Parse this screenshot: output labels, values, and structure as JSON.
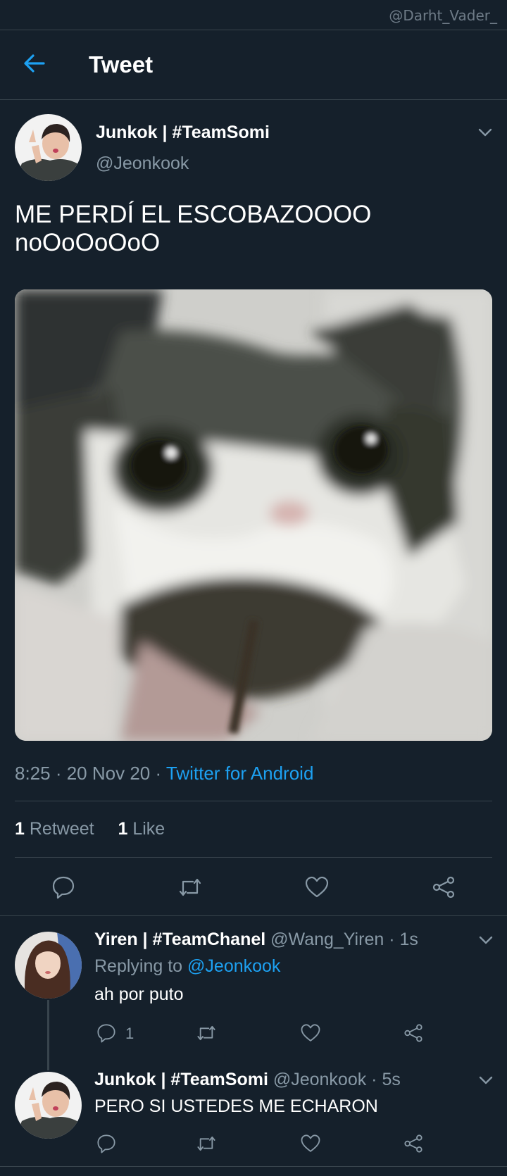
{
  "watermark": "@Darht_Vader_",
  "header": {
    "title": "Tweet"
  },
  "tweet": {
    "author_name": "Junkok | #TeamSomi",
    "author_handle": "@Jeonkook",
    "text_line1": "ME PERDÍ EL ESCOBAZOOOO",
    "text_line2": "noOoOoOoO",
    "time": "8:25 · 20 Nov 20 · ",
    "source": "Twitter for Android",
    "retweets_count": "1",
    "retweets_label": "Retweet",
    "likes_count": "1",
    "likes_label": "Like"
  },
  "replies": [
    {
      "name": "Yiren | #TeamChanel",
      "handle_time": " @Wang_Yiren · 1s",
      "replying_prefix": "Replying to ",
      "replying_handle": "@Jeonkook",
      "text": "ah por puto",
      "reply_count": "1"
    },
    {
      "name": "Junkok | #TeamSomi",
      "handle_time": " @Jeonkook · 5s",
      "text": "PERO SI USTEDES ME ECHARON"
    }
  ],
  "colors": {
    "background": "#15202b",
    "accent": "#1da1f2",
    "muted": "#8899a6",
    "divider": "#38444d"
  },
  "icons": [
    "back-arrow-icon",
    "chevron-down-icon",
    "reply-icon",
    "retweet-icon",
    "like-icon",
    "share-icon"
  ]
}
